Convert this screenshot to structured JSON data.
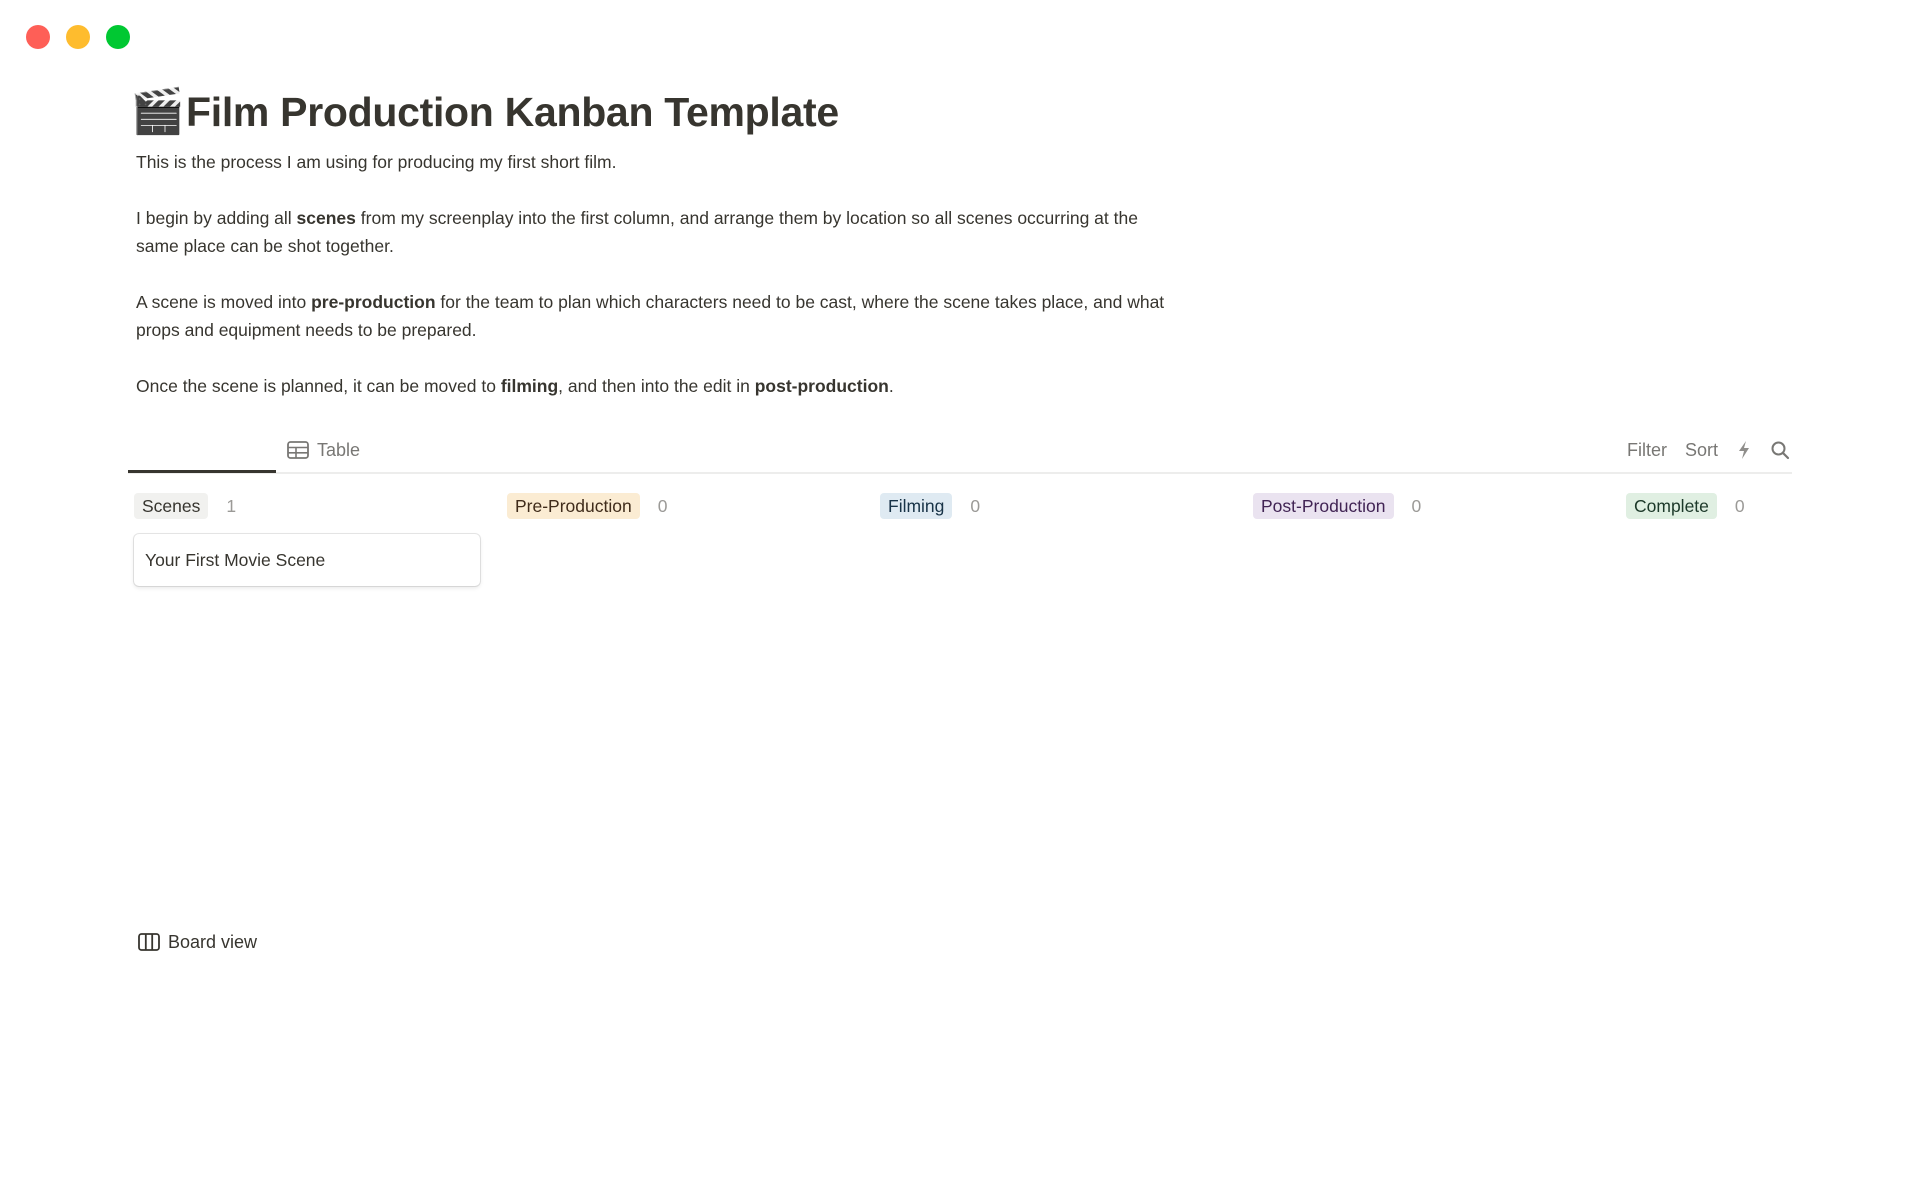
{
  "window": {
    "controls": [
      "close",
      "minimize",
      "maximize"
    ]
  },
  "page": {
    "icon": "🎬",
    "icon_name": "clapper-board-icon",
    "title": "Film Production Kanban Template"
  },
  "description": {
    "p1": "This is the process I am using for producing my first short film.",
    "p2": {
      "a": "I begin by adding all ",
      "b": "scenes",
      "c": " from my screenplay into the first column, and arrange them by location so all scenes occurring at the same place can be shot together."
    },
    "p3": {
      "a": "A scene is moved into ",
      "b": "pre-production",
      "c": " for the team to plan which characters need to be cast, where the scene takes place, and what props and equipment needs to be prepared."
    },
    "p4": {
      "a": "Once the scene is planned, it can be moved to ",
      "b": "filming",
      "c": ", and then into the edit in ",
      "d": "post-production",
      "e": "."
    }
  },
  "views": {
    "tabs": [
      {
        "label": "Board view",
        "icon": "board-icon",
        "active": true
      },
      {
        "label": "Table",
        "icon": "table-icon",
        "active": false
      }
    ],
    "toolbar": {
      "filter": "Filter",
      "sort": "Sort",
      "automation_icon": "lightning-icon",
      "search_icon": "search-icon"
    }
  },
  "board": {
    "columns": [
      {
        "label": "Scenes",
        "count": "1",
        "bg": "#f1f1ef",
        "fg": "#37352f",
        "cards": [
          "Your First Movie Scene"
        ]
      },
      {
        "label": "Pre-Production",
        "count": "0",
        "bg": "#fbecd3",
        "fg": "#402c1b",
        "cards": []
      },
      {
        "label": "Filming",
        "count": "0",
        "bg": "#dfeaf2",
        "fg": "#183347",
        "cards": []
      },
      {
        "label": "Post-Production",
        "count": "0",
        "bg": "#eae3f0",
        "fg": "#412454",
        "cards": []
      },
      {
        "label": "Complete",
        "count": "0",
        "bg": "#e0efe2",
        "fg": "#1c3829",
        "cards": []
      }
    ]
  }
}
